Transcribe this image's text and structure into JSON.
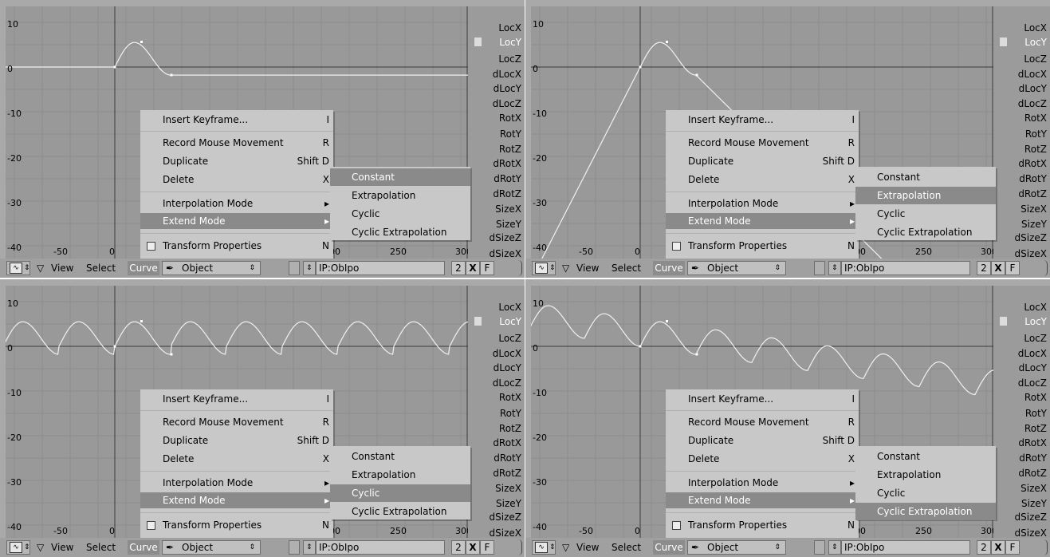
{
  "y_ticks": [
    "10",
    "0",
    "-10",
    "-20",
    "-30",
    "-40"
  ],
  "x_ticks": [
    "-50",
    "0",
    "00",
    "250",
    "300"
  ],
  "channels": [
    "LocX",
    "LocY",
    "LocZ",
    "dLocX",
    "dLocY",
    "dLocZ",
    "RotX",
    "RotY",
    "RotZ",
    "dRotX",
    "dRotY",
    "dRotZ",
    "SizeX",
    "SizeY",
    "dSizeZ",
    "dSizeX"
  ],
  "selected_channel": "LocY",
  "menu": {
    "insert_keyframe": "Insert Keyframe...",
    "insert_keyframe_key": "I",
    "record_mouse": "Record Mouse Movement",
    "record_mouse_key": "R",
    "duplicate": "Duplicate",
    "duplicate_key": "Shift D",
    "delete": "Delete",
    "delete_key": "X",
    "interpolation_mode": "Interpolation Mode",
    "extend_mode": "Extend Mode",
    "transform_properties": "Transform Properties",
    "transform_properties_key": "N"
  },
  "extend_submenu": [
    "Constant",
    "Extrapolation",
    "Cyclic",
    "Cyclic Extrapolation"
  ],
  "header": {
    "view": "View",
    "select": "Select",
    "curve": "Curve",
    "object": "Object",
    "ipo_name": "IP:ObIpo",
    "users": "2",
    "close": "X",
    "fake": "F"
  },
  "panels": [
    {
      "extend_mode": "Constant"
    },
    {
      "extend_mode": "Extrapolation"
    },
    {
      "extend_mode": "Cyclic"
    },
    {
      "extend_mode": "Cyclic Extrapolation"
    }
  ],
  "colors": {
    "highlight": "#8a8a8a",
    "menu_bg": "#c8c8c8",
    "graph_bg": "#999999",
    "curve": "#f0f0f0"
  },
  "icons": [
    "ipo-editor-icon",
    "disclosure-triangle-icon",
    "object-icon",
    "pin-icon",
    "close-icon"
  ]
}
